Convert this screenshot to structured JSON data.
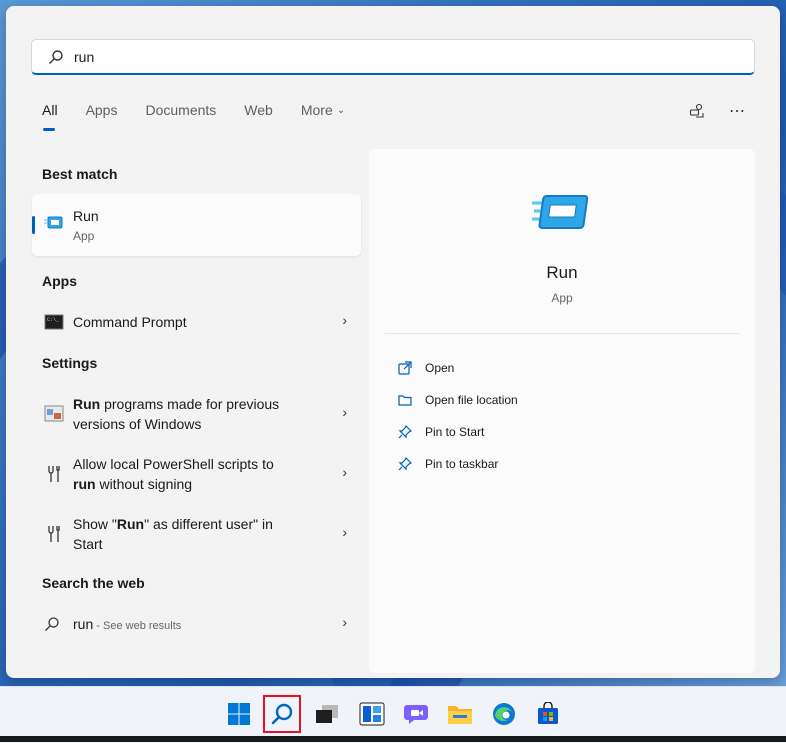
{
  "search": {
    "value": "run",
    "placeholder": ""
  },
  "tabs": [
    {
      "label": "All",
      "active": true
    },
    {
      "label": "Apps"
    },
    {
      "label": "Documents"
    },
    {
      "label": "Web"
    },
    {
      "label": "More"
    }
  ],
  "sections": {
    "best_match": "Best match",
    "apps": "Apps",
    "settings": "Settings",
    "search_web": "Search the web"
  },
  "best_match": {
    "title": "Run",
    "subtitle": "App"
  },
  "apps": [
    {
      "label": "Command Prompt"
    }
  ],
  "settings": [
    {
      "bold": "Run",
      "rest": " programs made for previous",
      "line2": "versions of Windows"
    },
    {
      "line1": "Allow local PowerShell scripts to",
      "bold": "run",
      "rest": " without signing"
    },
    {
      "pre": "Show \"",
      "bold": "Run",
      "post": "\" as different user\" in",
      "line2": "Start"
    }
  ],
  "web": {
    "query": "run",
    "hint": " - See web results"
  },
  "preview": {
    "title": "Run",
    "subtitle": "App",
    "actions": [
      "Open",
      "Open file location",
      "Pin to Start",
      "Pin to taskbar"
    ]
  },
  "colors": {
    "accent": "#005fb8",
    "highlight": "#e81123"
  },
  "taskbar_icons": [
    "windows-start-icon",
    "search-icon",
    "task-view-icon",
    "widgets-icon",
    "chat-icon",
    "file-explorer-icon",
    "edge-icon",
    "store-icon"
  ]
}
